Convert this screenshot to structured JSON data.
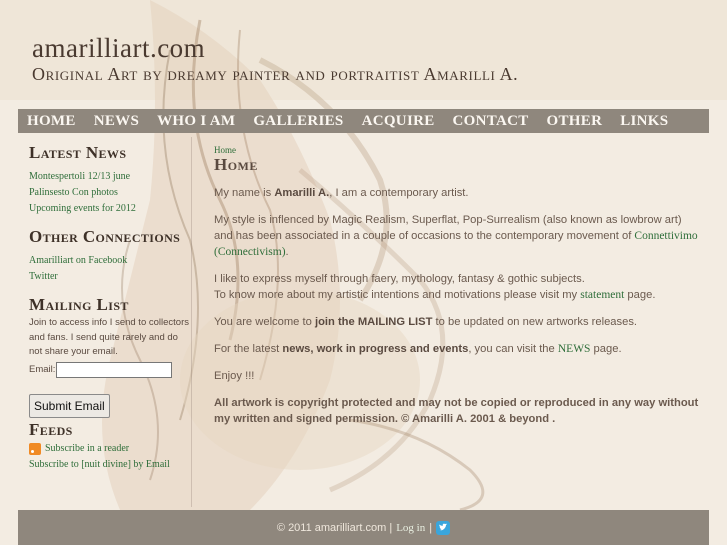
{
  "header": {
    "site_name": "amarilliart.com",
    "tagline": "Original Art by dreamy painter and portraitist Amarilli A."
  },
  "nav": {
    "items": [
      "HOME",
      "NEWS",
      "WHO I AM",
      "GALLERIES",
      "ACQUIRE",
      "CONTACT",
      "OTHER",
      "LINKS"
    ]
  },
  "sidebar": {
    "latest_news": {
      "title": "Latest News",
      "links": [
        "Montespertoli 12/13 june",
        "Palinsesto Con photos",
        "Upcoming events for 2012"
      ]
    },
    "other_connections": {
      "title": "Other Connections",
      "links": [
        "Amarilliart on Facebook",
        "Twitter"
      ]
    },
    "mailing_list": {
      "title": "Mailing List",
      "text": "Join to access info I send to collectors and fans. I send quite rarely and do not share your email.",
      "email_label": "Email:",
      "email_value": "",
      "submit_label": "Submit Email"
    },
    "feeds": {
      "title": "Feeds",
      "subscribe_reader": "Subscribe in a reader",
      "subscribe_email": "Subscribe to [nuit divine] by Email"
    }
  },
  "main": {
    "breadcrumb": "Home",
    "title": "Home",
    "p1_a": "My name is ",
    "p1_b": "Amarilli A.",
    "p1_c": ", I am a contemporary artist.",
    "p2_a": "My style is inflenced by Magic Realism, Superflat, Pop-Surrealism (also known  as lowbrow art)  and has been associated in a couple of occasions to the contemporary movement of ",
    "p2_link": "Connettivimo (Connectivism)",
    "p2_b": ".",
    "p3_a": "I like to express myself through faery, mythology, fantasy & gothic subjects.",
    "p3_b": "To know more about my artistic intentions and motivations please visit my ",
    "p3_link": "statement",
    "p3_c": " page.",
    "p4_a": "You are welcome to ",
    "p4_b": "join the MAILING LIST",
    "p4_c": " to be updated on new artworks releases.",
    "p5_a": "For the latest ",
    "p5_b": "news, work in progress and events",
    "p5_c": ", you can visit the ",
    "p5_link": "NEWS",
    "p5_d": " page.",
    "p6": "Enjoy !!!",
    "p7": "All artwork is copyright protected and may not be copied or reproduced in any way without my written and signed permission. © Amarilli A. 2001 & beyond ."
  },
  "footer": {
    "copyright": "© 2011 amarilliart.com |",
    "login": "Log in",
    "separator": "|"
  },
  "colors": {
    "nav_bg": "#8f877d",
    "link_green": "#2f6e3a",
    "page_bg": "#f3ece2"
  }
}
